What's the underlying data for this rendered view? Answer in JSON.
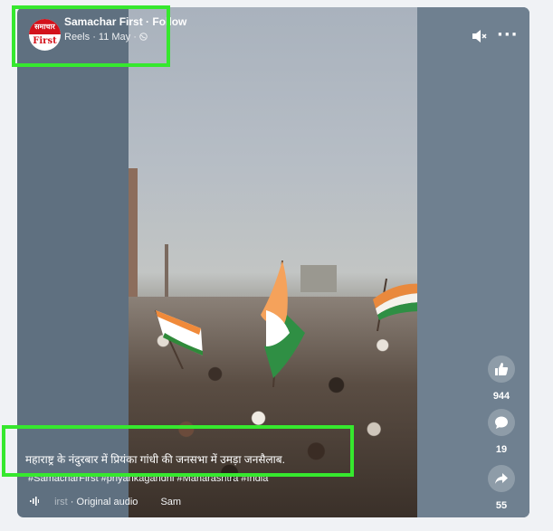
{
  "post": {
    "page_name": "Samachar First · Follow",
    "reels_label": "Reels",
    "date": "11 May",
    "logo_top_text": "समाचार",
    "logo_bottom_text": "First"
  },
  "caption": {
    "text": "महाराष्ट्र के नंदुरबार में प्रियंका गांधी की जनसभा में उमड़ा जनसैलाब.",
    "hashtags": "#SamacharFirst #priyankagandhi #Maharashtra #India"
  },
  "audio": {
    "source": "irst",
    "label": "Original audio",
    "next": "Sam"
  },
  "actions": {
    "likes": "944",
    "comments": "19",
    "shares": "55"
  },
  "icons": [
    "mute-icon",
    "more-icon",
    "globe-icon",
    "like-icon",
    "comment-icon",
    "share-icon",
    "audio-wave-icon"
  ],
  "colors": {
    "highlight": "#36e82e",
    "brand_red": "#d3121b"
  }
}
